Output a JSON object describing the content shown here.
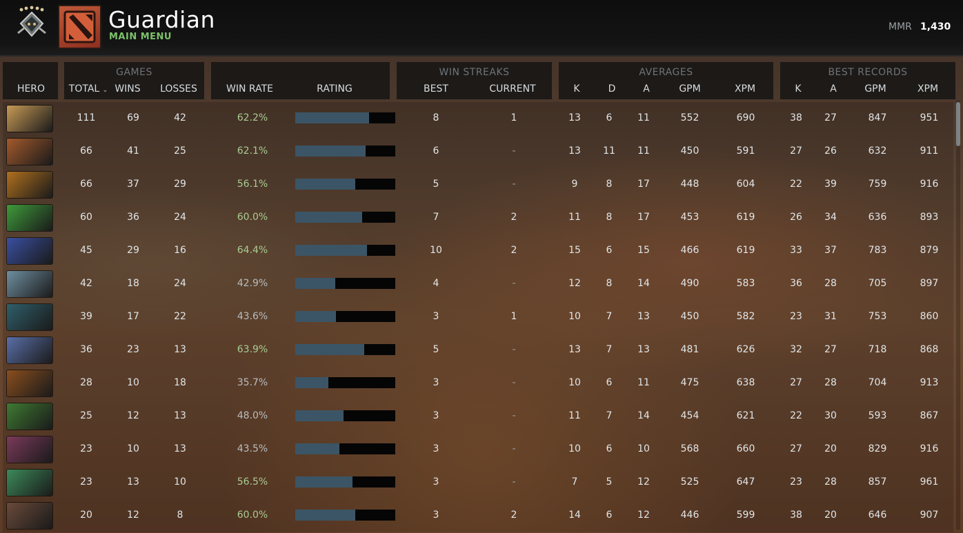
{
  "header": {
    "title": "Guardian",
    "subtitle": "MAIN MENU",
    "mmr_label": "MMR",
    "mmr_value": "1,430"
  },
  "columns": {
    "hero": "HERO",
    "games_group": "GAMES",
    "total": "TOTAL",
    "wins": "WINS",
    "losses": "LOSSES",
    "win_rate": "WIN RATE",
    "rating": "RATING",
    "streaks_group": "WIN STREAKS",
    "best": "BEST",
    "current": "CURRENT",
    "averages_group": "AVERAGES",
    "k": "K",
    "d": "D",
    "a": "A",
    "gpm": "GPM",
    "xpm": "XPM",
    "records_group": "BEST RECORDS",
    "rk": "K",
    "ra": "A",
    "rgpm": "GPM",
    "rxpm": "XPM"
  },
  "rows": [
    {
      "portrait_color": "#c79a56",
      "total": "111",
      "wins": "69",
      "losses": "42",
      "win_rate": "62.2%",
      "rating": 0.74,
      "best": "8",
      "current": "1",
      "k": "13",
      "d": "6",
      "a": "11",
      "gpm": "552",
      "xpm": "690",
      "rk": "38",
      "ra": "27",
      "rgpm": "847",
      "rxpm": "951"
    },
    {
      "portrait_color": "#a35a2c",
      "total": "66",
      "wins": "41",
      "losses": "25",
      "win_rate": "62.1%",
      "rating": 0.7,
      "best": "6",
      "current": "-",
      "k": "13",
      "d": "11",
      "a": "11",
      "gpm": "450",
      "xpm": "591",
      "rk": "27",
      "ra": "26",
      "rgpm": "632",
      "rxpm": "911"
    },
    {
      "portrait_color": "#b0701e",
      "total": "66",
      "wins": "37",
      "losses": "29",
      "win_rate": "56.1%",
      "rating": 0.6,
      "best": "5",
      "current": "-",
      "k": "9",
      "d": "8",
      "a": "17",
      "gpm": "448",
      "xpm": "604",
      "rk": "22",
      "ra": "39",
      "rgpm": "759",
      "rxpm": "916"
    },
    {
      "portrait_color": "#3e9a3a",
      "total": "60",
      "wins": "36",
      "losses": "24",
      "win_rate": "60.0%",
      "rating": 0.67,
      "best": "7",
      "current": "2",
      "k": "11",
      "d": "8",
      "a": "17",
      "gpm": "453",
      "xpm": "619",
      "rk": "26",
      "ra": "34",
      "rgpm": "636",
      "rxpm": "893"
    },
    {
      "portrait_color": "#3a4fa0",
      "total": "45",
      "wins": "29",
      "losses": "16",
      "win_rate": "64.4%",
      "rating": 0.72,
      "best": "10",
      "current": "2",
      "k": "15",
      "d": "6",
      "a": "15",
      "gpm": "466",
      "xpm": "619",
      "rk": "33",
      "ra": "37",
      "rgpm": "783",
      "rxpm": "879"
    },
    {
      "portrait_color": "#6f8fa0",
      "total": "42",
      "wins": "18",
      "losses": "24",
      "win_rate": "42.9%",
      "rating": 0.4,
      "best": "4",
      "current": "-",
      "k": "12",
      "d": "8",
      "a": "14",
      "gpm": "490",
      "xpm": "583",
      "rk": "36",
      "ra": "28",
      "rgpm": "705",
      "rxpm": "897"
    },
    {
      "portrait_color": "#2f5f6a",
      "total": "39",
      "wins": "17",
      "losses": "22",
      "win_rate": "43.6%",
      "rating": 0.41,
      "best": "3",
      "current": "1",
      "k": "10",
      "d": "7",
      "a": "13",
      "gpm": "450",
      "xpm": "582",
      "rk": "23",
      "ra": "31",
      "rgpm": "753",
      "rxpm": "860"
    },
    {
      "portrait_color": "#5a6fa8",
      "total": "36",
      "wins": "23",
      "losses": "13",
      "win_rate": "63.9%",
      "rating": 0.69,
      "best": "5",
      "current": "-",
      "k": "13",
      "d": "7",
      "a": "13",
      "gpm": "481",
      "xpm": "626",
      "rk": "32",
      "ra": "27",
      "rgpm": "718",
      "rxpm": "868"
    },
    {
      "portrait_color": "#8a4e1e",
      "total": "28",
      "wins": "10",
      "losses": "18",
      "win_rate": "35.7%",
      "rating": 0.33,
      "best": "3",
      "current": "-",
      "k": "10",
      "d": "6",
      "a": "11",
      "gpm": "475",
      "xpm": "638",
      "rk": "27",
      "ra": "28",
      "rgpm": "704",
      "rxpm": "913"
    },
    {
      "portrait_color": "#3f7a32",
      "total": "25",
      "wins": "12",
      "losses": "13",
      "win_rate": "48.0%",
      "rating": 0.48,
      "best": "3",
      "current": "-",
      "k": "11",
      "d": "7",
      "a": "14",
      "gpm": "454",
      "xpm": "621",
      "rk": "22",
      "ra": "30",
      "rgpm": "593",
      "rxpm": "867"
    },
    {
      "portrait_color": "#7a3a5a",
      "total": "23",
      "wins": "10",
      "losses": "13",
      "win_rate": "43.5%",
      "rating": 0.44,
      "best": "3",
      "current": "-",
      "k": "10",
      "d": "6",
      "a": "10",
      "gpm": "568",
      "xpm": "660",
      "rk": "27",
      "ra": "20",
      "rgpm": "829",
      "rxpm": "916"
    },
    {
      "portrait_color": "#3c8a5a",
      "total": "23",
      "wins": "13",
      "losses": "10",
      "win_rate": "56.5%",
      "rating": 0.57,
      "best": "3",
      "current": "-",
      "k": "7",
      "d": "5",
      "a": "12",
      "gpm": "525",
      "xpm": "647",
      "rk": "23",
      "ra": "28",
      "rgpm": "857",
      "rxpm": "961"
    },
    {
      "portrait_color": "#6a4a3a",
      "total": "20",
      "wins": "12",
      "losses": "8",
      "win_rate": "60.0%",
      "rating": 0.6,
      "best": "3",
      "current": "2",
      "k": "14",
      "d": "6",
      "a": "12",
      "gpm": "446",
      "xpm": "599",
      "rk": "38",
      "ra": "20",
      "rgpm": "646",
      "rxpm": "907"
    }
  ]
}
